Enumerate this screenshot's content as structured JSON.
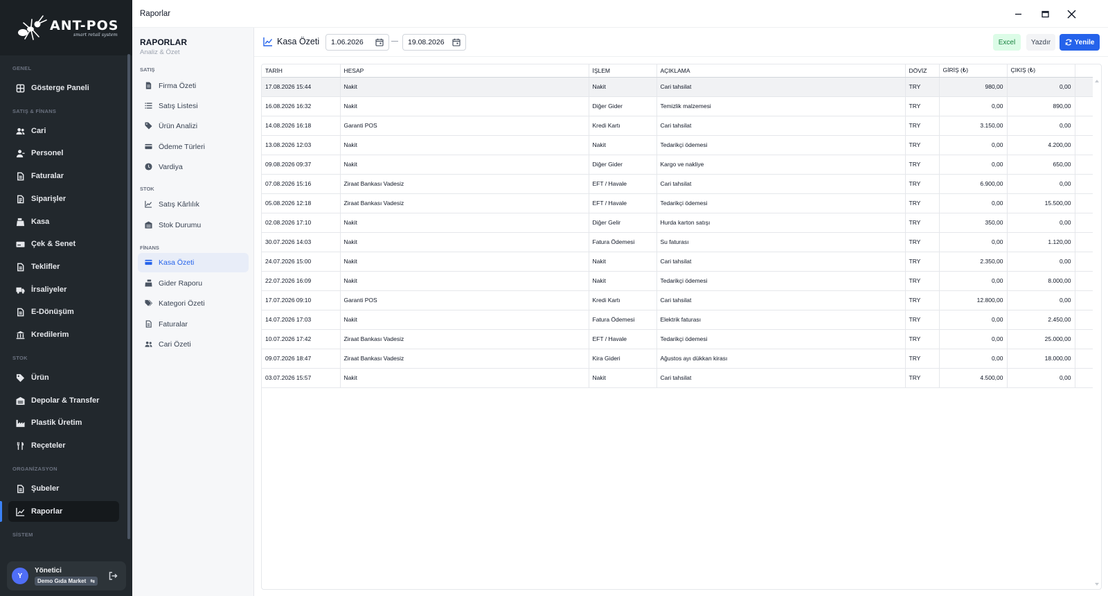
{
  "brand": {
    "name": "ANT-POS",
    "tagline": "smart retail system"
  },
  "sidebar": {
    "sections": [
      {
        "label": "GENEL"
      },
      {
        "label": "SATIŞ & FİNANS"
      },
      {
        "label": "STOK"
      },
      {
        "label": "ORGANİZASYON"
      },
      {
        "label": "SİSTEM"
      }
    ],
    "items": [
      {
        "label": "Gösterge Paneli",
        "icon": "dashboard-icon"
      },
      {
        "label": "Cari",
        "icon": "users-icon"
      },
      {
        "label": "Personel",
        "icon": "personnel-icon"
      },
      {
        "label": "Faturalar",
        "icon": "invoice-icon"
      },
      {
        "label": "Siparişler",
        "icon": "orders-icon"
      },
      {
        "label": "Kasa",
        "icon": "cash-register-icon"
      },
      {
        "label": "Çek & Senet",
        "icon": "cheque-icon"
      },
      {
        "label": "Teklifler",
        "icon": "offer-icon"
      },
      {
        "label": "İrsaliyeler",
        "icon": "truck-icon"
      },
      {
        "label": "E-Dönüşüm",
        "icon": "e-document-icon"
      },
      {
        "label": "Kredilerim",
        "icon": "bank-icon"
      },
      {
        "label": "Ürün",
        "icon": "tag-icon"
      },
      {
        "label": "Depolar & Transfer",
        "icon": "warehouse-icon"
      },
      {
        "label": "Plastik Üretim",
        "icon": "factory-icon"
      },
      {
        "label": "Reçeteler",
        "icon": "recipe-icon"
      },
      {
        "label": "Şubeler",
        "icon": "branch-icon"
      },
      {
        "label": "Raporlar",
        "icon": "chart-line-icon"
      }
    ],
    "user": {
      "initial": "Y",
      "name": "Yönetici",
      "company": "Demo Gıda Market"
    }
  },
  "window": {
    "title": "Raporlar"
  },
  "report_menu": {
    "title": "RAPORLAR",
    "subtitle": "Analiz & Özet",
    "sections": [
      {
        "label": "SATIŞ"
      },
      {
        "label": "STOK"
      },
      {
        "label": "FİNANS"
      }
    ],
    "items": [
      {
        "label": "Firma Özeti"
      },
      {
        "label": "Satış Listesi"
      },
      {
        "label": "Ürün Analizi"
      },
      {
        "label": "Ödeme Türleri"
      },
      {
        "label": "Vardiya"
      },
      {
        "label": "Satış Kârlılık"
      },
      {
        "label": "Stok Durumu"
      },
      {
        "label": "Kasa Özeti"
      },
      {
        "label": "Gider Raporu"
      },
      {
        "label": "Kategori Özeti"
      },
      {
        "label": "Faturalar"
      },
      {
        "label": "Cari Özeti"
      }
    ]
  },
  "main": {
    "title": "Kasa Özeti",
    "date_from": "1.06.2026",
    "date_to": "19.08.2026",
    "buttons": {
      "excel": "Excel",
      "print": "Yazdır",
      "refresh": "Yenile"
    }
  },
  "table": {
    "columns": [
      "TARİH",
      "HESAP",
      "İŞLEM",
      "AÇIKLAMA",
      "DÖVİZ",
      "GİRİŞ (₺)",
      "ÇIKIŞ (₺)"
    ],
    "rows": [
      [
        "17.08.2026 15:44",
        "Nakit",
        "Nakit",
        "Cari tahsilat",
        "TRY",
        "980,00",
        "0,00"
      ],
      [
        "16.08.2026 16:32",
        "Nakit",
        "Diğer Gider",
        "Temizlik malzemesi",
        "TRY",
        "0,00",
        "890,00"
      ],
      [
        "14.08.2026 16:18",
        "Garanti POS",
        "Kredi Kartı",
        "Cari tahsilat",
        "TRY",
        "3.150,00",
        "0,00"
      ],
      [
        "13.08.2026 12:03",
        "Nakit",
        "Nakit",
        "Tedarikçi ödemesi",
        "TRY",
        "0,00",
        "4.200,00"
      ],
      [
        "09.08.2026 09:37",
        "Nakit",
        "Diğer Gider",
        "Kargo ve nakliye",
        "TRY",
        "0,00",
        "650,00"
      ],
      [
        "07.08.2026 15:16",
        "Ziraat Bankası Vadesiz",
        "EFT / Havale",
        "Cari tahsilat",
        "TRY",
        "6.900,00",
        "0,00"
      ],
      [
        "05.08.2026 12:18",
        "Ziraat Bankası Vadesiz",
        "EFT / Havale",
        "Tedarikçi ödemesi",
        "TRY",
        "0,00",
        "15.500,00"
      ],
      [
        "02.08.2026 17:10",
        "Nakit",
        "Diğer Gelir",
        "Hurda karton satışı",
        "TRY",
        "350,00",
        "0,00"
      ],
      [
        "30.07.2026 14:03",
        "Nakit",
        "Fatura Ödemesi",
        "Su faturası",
        "TRY",
        "0,00",
        "1.120,00"
      ],
      [
        "24.07.2026 15:00",
        "Nakit",
        "Nakit",
        "Cari tahsilat",
        "TRY",
        "2.350,00",
        "0,00"
      ],
      [
        "22.07.2026 16:09",
        "Nakit",
        "Nakit",
        "Tedarikçi ödemesi",
        "TRY",
        "0,00",
        "8.000,00"
      ],
      [
        "17.07.2026 09:10",
        "Garanti POS",
        "Kredi Kartı",
        "Cari tahsilat",
        "TRY",
        "12.800,00",
        "0,00"
      ],
      [
        "14.07.2026 17:03",
        "Nakit",
        "Fatura Ödemesi",
        "Elektrik faturası",
        "TRY",
        "0,00",
        "2.450,00"
      ],
      [
        "10.07.2026 17:42",
        "Ziraat Bankası Vadesiz",
        "EFT / Havale",
        "Tedarikçi ödemesi",
        "TRY",
        "0,00",
        "25.000,00"
      ],
      [
        "09.07.2026 18:47",
        "Ziraat Bankası Vadesiz",
        "Kira Gideri",
        "Ağustos ayı dükkan kirası",
        "TRY",
        "0,00",
        "18.000,00"
      ],
      [
        "03.07.2026 15:57",
        "Nakit",
        "Nakit",
        "Cari tahsilat",
        "TRY",
        "4.500,00",
        "0,00"
      ]
    ]
  },
  "colors": {
    "accent": "#2563eb",
    "sidebar_bg": "#22282d",
    "excel_bg": "#dcfce7",
    "excel_text": "#15803d"
  }
}
